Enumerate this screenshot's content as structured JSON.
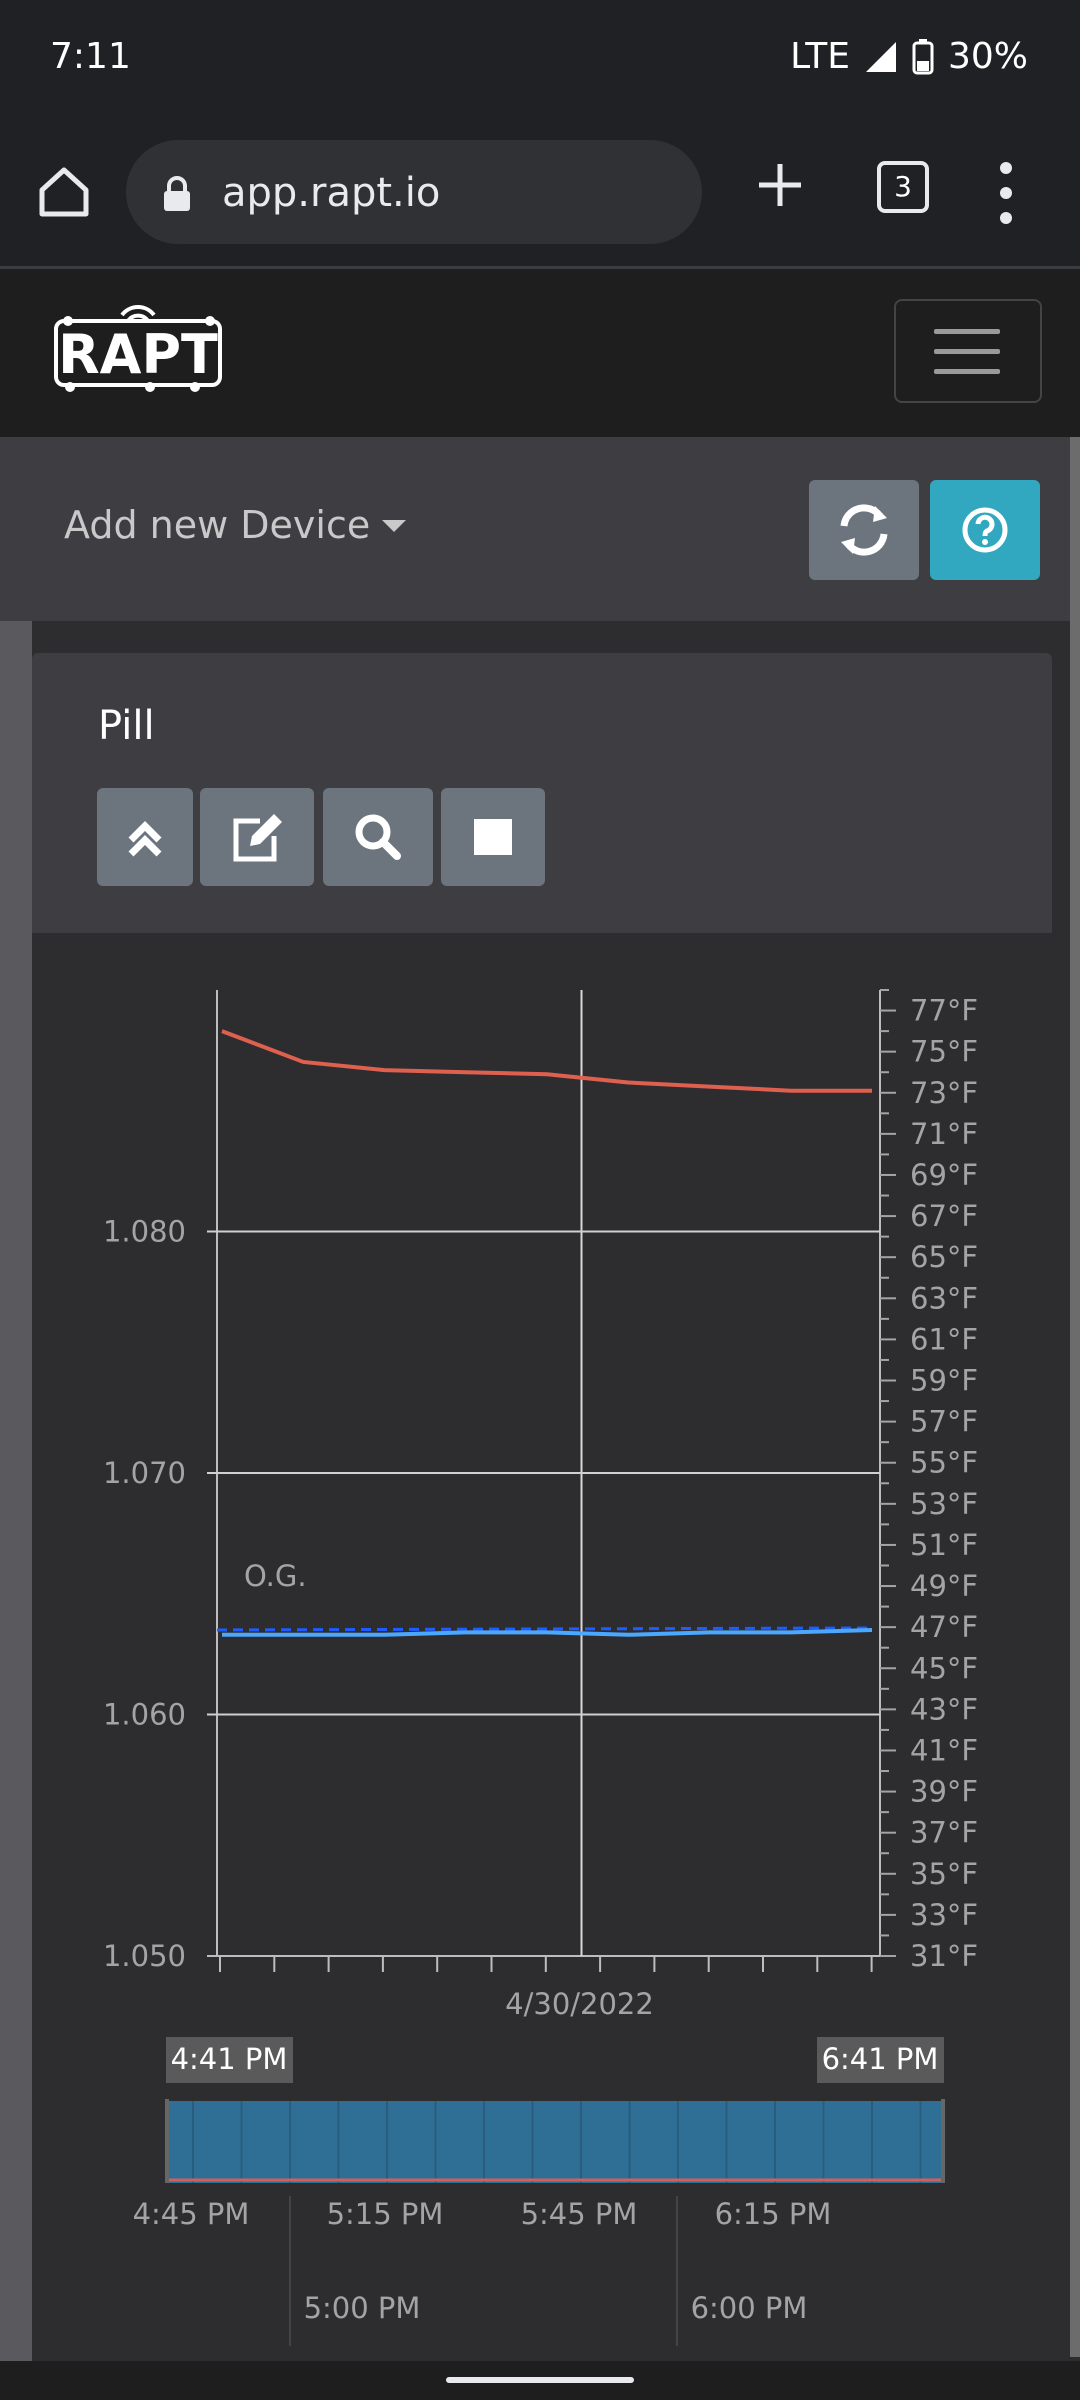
{
  "status_bar": {
    "time": "7:11",
    "network": "LTE",
    "battery": "30%"
  },
  "browser": {
    "url": "app.rapt.io",
    "tab_count": "3",
    "icons": [
      "home-icon",
      "lock-icon",
      "plus-icon",
      "kebab-icon"
    ]
  },
  "nav": {
    "logo_text": "RAPT"
  },
  "toolbar": {
    "add_device_label": "Add new Device",
    "refresh_icon": "refresh-icon",
    "help_icon": "help-icon",
    "help_color": "#31a8bf"
  },
  "card": {
    "title": "Pill",
    "buttons": [
      "collapse-icon",
      "edit-icon",
      "search-icon",
      "stop-icon"
    ]
  },
  "chart_data": {
    "type": "line",
    "x_label": "4/30/2022",
    "x_minutes": [
      0,
      15,
      30,
      45,
      60,
      75,
      90,
      105,
      120
    ],
    "series": [
      {
        "axis": "temperature",
        "color": "#e0604f",
        "values": [
          76.0,
          74.5,
          74.1,
          74.0,
          73.9,
          73.5,
          73.3,
          73.1,
          73.1
        ]
      },
      {
        "axis": "gravity",
        "color": "#4aa8ff",
        "values": [
          1.0633,
          1.0633,
          1.0633,
          1.0634,
          1.0634,
          1.0633,
          1.0634,
          1.0634,
          1.0635
        ]
      }
    ],
    "og_label": "O.G.",
    "og_value": 1.0635,
    "y_left": {
      "range": [
        1.05,
        1.09
      ],
      "ticks": [
        "1.050",
        "1.060",
        "1.070",
        "1.080"
      ]
    },
    "y_right": {
      "range": [
        31,
        78
      ],
      "ticks": [
        "31°F",
        "33°F",
        "35°F",
        "37°F",
        "39°F",
        "41°F",
        "43°F",
        "45°F",
        "47°F",
        "49°F",
        "51°F",
        "53°F",
        "55°F",
        "57°F",
        "59°F",
        "61°F",
        "63°F",
        "65°F",
        "67°F",
        "69°F",
        "71°F",
        "73°F",
        "75°F",
        "77°F"
      ]
    },
    "range_start": "4:41 PM",
    "range_end": "6:41 PM",
    "nav_ticks": [
      "4:45 PM",
      "5:15 PM",
      "5:45 PM",
      "6:15 PM"
    ],
    "nav_major_ticks": [
      "5:00 PM",
      "6:00 PM"
    ],
    "grid": true
  }
}
